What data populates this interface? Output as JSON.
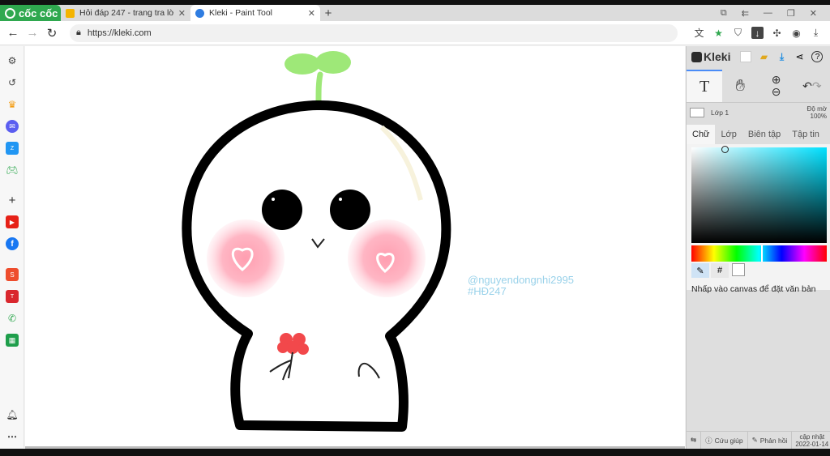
{
  "browser": {
    "brand": "cốc cốc",
    "tabs": [
      {
        "title": "Hỏi đáp 247 - trang tra lời",
        "icon": "hoidap-favicon",
        "color": "#f4b400"
      },
      {
        "title": "Kleki - Paint Tool",
        "icon": "kleki-favicon",
        "color": "#2f7de1"
      }
    ],
    "url": "https://kleki.com"
  },
  "sidebar": {
    "icons": [
      "settings-icon",
      "history-icon",
      "crown-icon",
      "messenger-icon",
      "zalo-icon",
      "gamepad-icon",
      "add-icon",
      "youtube-icon",
      "facebook-icon",
      "shopee-icon",
      "tiki-icon",
      "whatsapp-icon",
      "sheets-icon",
      "bell-icon",
      "more-icon"
    ]
  },
  "canvas": {
    "watermark_line1": "@nguyendongnhi2995",
    "watermark_line2": "#HĐ247"
  },
  "kleki": {
    "brand": "Kleki",
    "layer_name": "Lớp 1",
    "opacity_label": "Độ mờ",
    "opacity_value": "100%",
    "tabs": [
      "Chữ",
      "Lớp",
      "Biên tập",
      "Tập tin"
    ],
    "active_tab": "Chữ",
    "hint": "Nhấp vào canvas để đặt văn bản",
    "footer": {
      "help": "Cứu giúp",
      "feedback": "Phản hồi",
      "update_label": "cập nhật",
      "update_date": "2022-01-14"
    },
    "hue_color": "#00e1ff"
  }
}
